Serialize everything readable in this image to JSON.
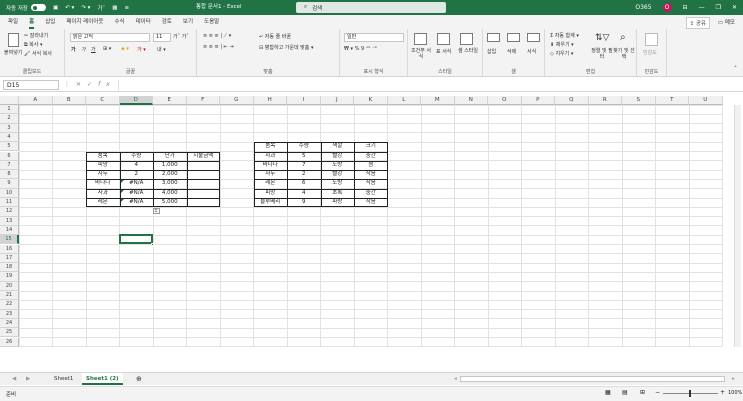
{
  "titlebar": {
    "autosave_label": "자동 저장",
    "autosave_state": "끔",
    "title": "통합 문서1 - Excel",
    "search_placeholder": "검색",
    "user": "O365",
    "avatar_initial": "O"
  },
  "menu_tabs": [
    "파일",
    "홈",
    "삽입",
    "페이지 레이아웃",
    "수식",
    "데이터",
    "검토",
    "보기",
    "도움말"
  ],
  "active_tab": "홈",
  "share_label": "공유",
  "memo_label": "메모",
  "ribbon": {
    "clipboard": {
      "paste": "붙여넣기",
      "cut": "잘라내기",
      "copy": "복사",
      "format_painter": "서식 복사",
      "label": "클립보드"
    },
    "font": {
      "font_name": "맑은 고딕",
      "font_size": "11",
      "bold": "가",
      "italic": "가",
      "underline": "가",
      "label": "글꼴"
    },
    "alignment": {
      "wrap": "자동 줄 바꿈",
      "merge": "병합하고 가운데 맞춤",
      "label": "맞춤"
    },
    "number": {
      "format": "일반",
      "label": "표시 형식"
    },
    "styles": {
      "conditional": "조건부 서식",
      "table": "표 서식",
      "cell_styles": "셀 스타일",
      "label": "스타일"
    },
    "cells": {
      "insert": "삽입",
      "delete": "삭제",
      "format": "서식",
      "label": "셀"
    },
    "editing": {
      "autosum": "자동 합계",
      "fill": "채우기",
      "clear": "지우기",
      "sort": "정렬 및 필터",
      "find": "찾기 및 선택",
      "label": "편집"
    },
    "sensitivity": {
      "label": "민감도",
      "button": "민감도"
    }
  },
  "name_box": "D15",
  "formula_bar": "",
  "columns": [
    "A",
    "B",
    "C",
    "D",
    "E",
    "F",
    "G",
    "H",
    "I",
    "J",
    "K",
    "L",
    "M",
    "N",
    "O",
    "P",
    "Q",
    "R",
    "S",
    "T",
    "U"
  ],
  "rows": [
    "1",
    "2",
    "3",
    "4",
    "5",
    "6",
    "7",
    "8",
    "9",
    "10",
    "11",
    "12",
    "13",
    "14",
    "15",
    "16",
    "17",
    "18",
    "19",
    "20",
    "21",
    "22",
    "23",
    "24",
    "25",
    "26"
  ],
  "selected_cell": "D15",
  "table1": {
    "headers": [
      "품목",
      "수량",
      "단가",
      "지불금액"
    ],
    "rows": [
      [
        "피망",
        "4",
        "1,000",
        ""
      ],
      [
        "자두",
        "2",
        "2,000",
        ""
      ],
      [
        "바나나",
        "#N/A",
        "3,000",
        ""
      ],
      [
        "사과",
        "#N/A",
        "4,000",
        ""
      ],
      [
        "레몬",
        "#N/A",
        "5,000",
        ""
      ]
    ]
  },
  "table2": {
    "headers": [
      "품목",
      "수량",
      "색깔",
      "크기"
    ],
    "rows": [
      [
        "사과",
        "5",
        "빨강",
        "중간"
      ],
      [
        "바나나",
        "7",
        "노랑",
        "큼"
      ],
      [
        "자두",
        "2",
        "빨강",
        "작음"
      ],
      [
        "레몬",
        "6",
        "노랑",
        "작음"
      ],
      [
        "피망",
        "4",
        "초록",
        "중간"
      ],
      [
        "블루베리",
        "9",
        "파랑",
        "작음"
      ]
    ]
  },
  "sheets": [
    "Sheet1",
    "Sheet1 (2)"
  ],
  "active_sheet": "Sheet1 (2)",
  "status": {
    "ready": "준비",
    "zoom": "100%"
  },
  "colors": {
    "accent": "#217346",
    "avatar": "#c2185b"
  }
}
